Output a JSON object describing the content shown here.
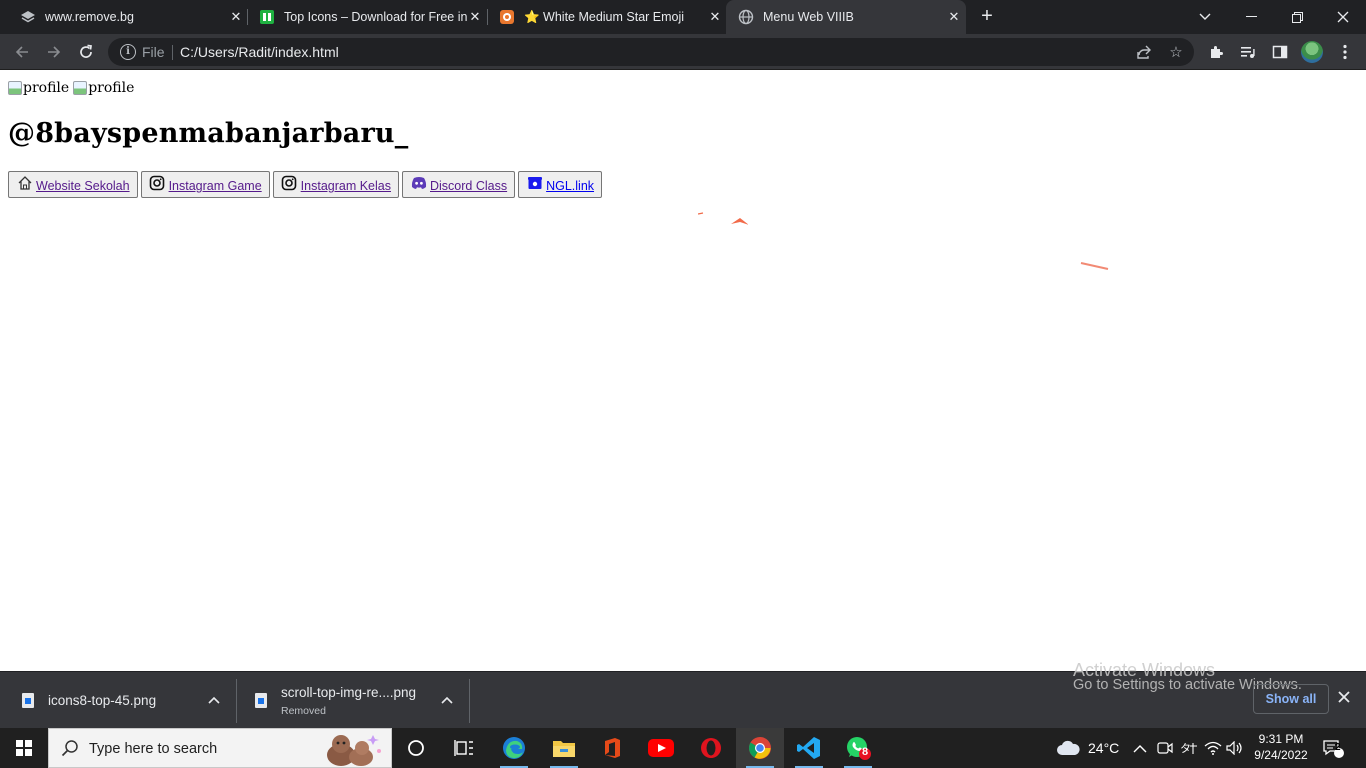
{
  "browser": {
    "tabs": [
      {
        "title": "www.remove.bg",
        "favicon": "layers-icon",
        "active": false
      },
      {
        "title": "Top Icons – Download for Free in",
        "favicon": "icons8-icon",
        "active": false
      },
      {
        "title": "⭐ White Medium Star Emoji",
        "favicon": "emojipedia-icon",
        "active": false
      },
      {
        "title": "Menu Web VIIIB",
        "favicon": "globe-icon",
        "active": true
      }
    ],
    "address_bar": {
      "scheme_label": "File",
      "url": "C:/Users/Radit/index.html"
    }
  },
  "page": {
    "profile_images": [
      {
        "alt": "profile"
      },
      {
        "alt": "profile"
      }
    ],
    "handle": "@8bayspenmabanjarbaru_",
    "links": [
      {
        "label": "Website Sekolah",
        "icon": "home-icon",
        "visited": true
      },
      {
        "label": "Instagram Game",
        "icon": "instagram-icon",
        "visited": true
      },
      {
        "label": "Instagram Kelas",
        "icon": "instagram-icon",
        "visited": true
      },
      {
        "label": "Discord Class",
        "icon": "discord-icon",
        "visited": true
      },
      {
        "label": "NGL.link",
        "icon": "ngl-box-icon",
        "visited": false
      }
    ]
  },
  "downloads": {
    "items": [
      {
        "name": "icons8-top-45.png",
        "status": ""
      },
      {
        "name": "scroll-top-img-re....png",
        "status": "Removed"
      }
    ],
    "show_all_label": "Show all"
  },
  "watermark": {
    "line1": "Activate Windows",
    "line2": "Go to Settings to activate Windows."
  },
  "taskbar": {
    "search_placeholder": "Type here to search",
    "weather": "24°C",
    "time": "9:31 PM",
    "date": "9/24/2022",
    "notification_count": "2",
    "whatsapp_badge": "8"
  }
}
